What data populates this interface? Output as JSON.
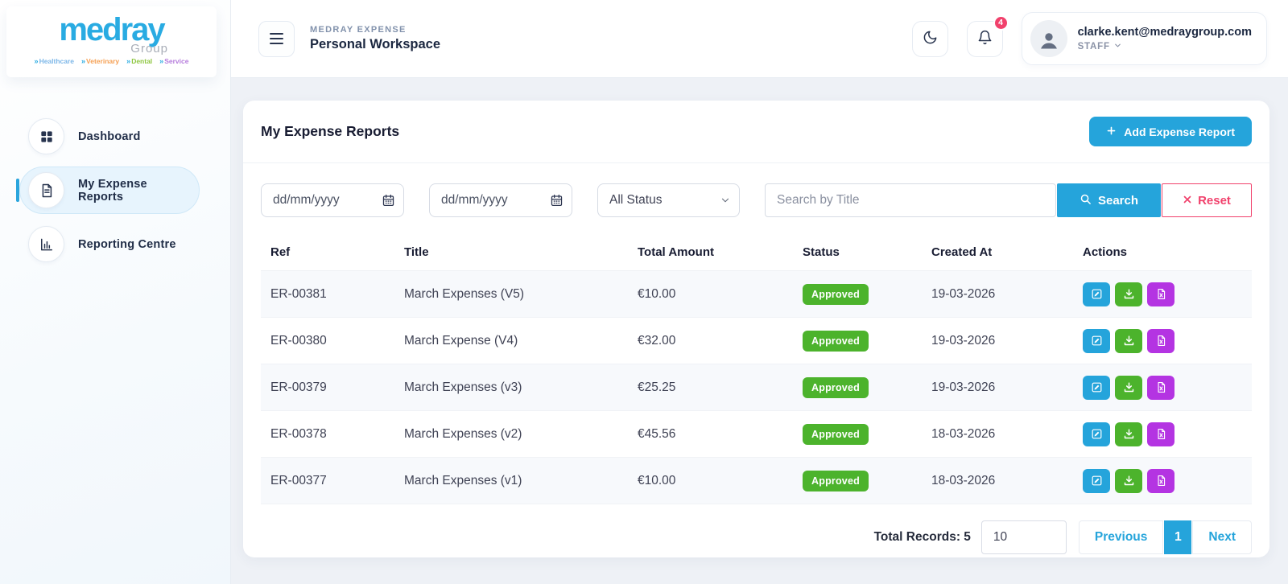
{
  "brand": {
    "wordmark": "medray",
    "subtitle": "Group",
    "tags": [
      {
        "label": "Healthcare",
        "color": "#7db7e8"
      },
      {
        "label": "Veterinary",
        "color": "#f5a054"
      },
      {
        "label": "Dental",
        "color": "#8dc63f"
      },
      {
        "label": "Service",
        "color": "#b57bdc"
      }
    ]
  },
  "sidebar": {
    "items": [
      {
        "label": "Dashboard",
        "icon": "grid-icon",
        "active": false
      },
      {
        "label": "My Expense Reports",
        "icon": "document-icon",
        "active": true
      },
      {
        "label": "Reporting Centre",
        "icon": "bar-chart-icon",
        "active": false
      }
    ]
  },
  "header": {
    "app_name": "MEDRAY EXPENSE",
    "workspace": "Personal Workspace",
    "notification_count": "4",
    "user_email": "clarke.kent@medraygroup.com",
    "user_role": "STAFF"
  },
  "card": {
    "title": "My Expense Reports",
    "add_button": "Add Expense Report"
  },
  "filters": {
    "date_from_placeholder": "dd/mm/yyyy",
    "date_to_placeholder": "dd/mm/yyyy",
    "status_selected": "All Status",
    "search_placeholder": "Search by Title",
    "search_label": "Search",
    "reset_label": "Reset"
  },
  "table": {
    "columns": [
      "Ref",
      "Title",
      "Total Amount",
      "Status",
      "Created At",
      "Actions"
    ],
    "rows": [
      {
        "ref": "ER-00381",
        "title": "March Expenses (V5)",
        "amount": "€10.00",
        "status": "Approved",
        "created": "19-03-2026"
      },
      {
        "ref": "ER-00380",
        "title": "March Expense (V4)",
        "amount": "€32.00",
        "status": "Approved",
        "created": "19-03-2026"
      },
      {
        "ref": "ER-00379",
        "title": "March Expenses (v3)",
        "amount": "€25.25",
        "status": "Approved",
        "created": "19-03-2026"
      },
      {
        "ref": "ER-00378",
        "title": "March Expenses (v2)",
        "amount": "€45.56",
        "status": "Approved",
        "created": "18-03-2026"
      },
      {
        "ref": "ER-00377",
        "title": "March Expenses (v1)",
        "amount": "€10.00",
        "status": "Approved",
        "created": "18-03-2026"
      }
    ]
  },
  "pagination": {
    "total_label": "Total Records: 5",
    "page_size": "10",
    "previous": "Previous",
    "current": "1",
    "next": "Next"
  },
  "colors": {
    "primary": "#25a4db",
    "brand_blue": "#29abe2",
    "success": "#4cb32c",
    "purple": "#b434e2",
    "danger": "#f1416c",
    "navy": "#181c32"
  }
}
